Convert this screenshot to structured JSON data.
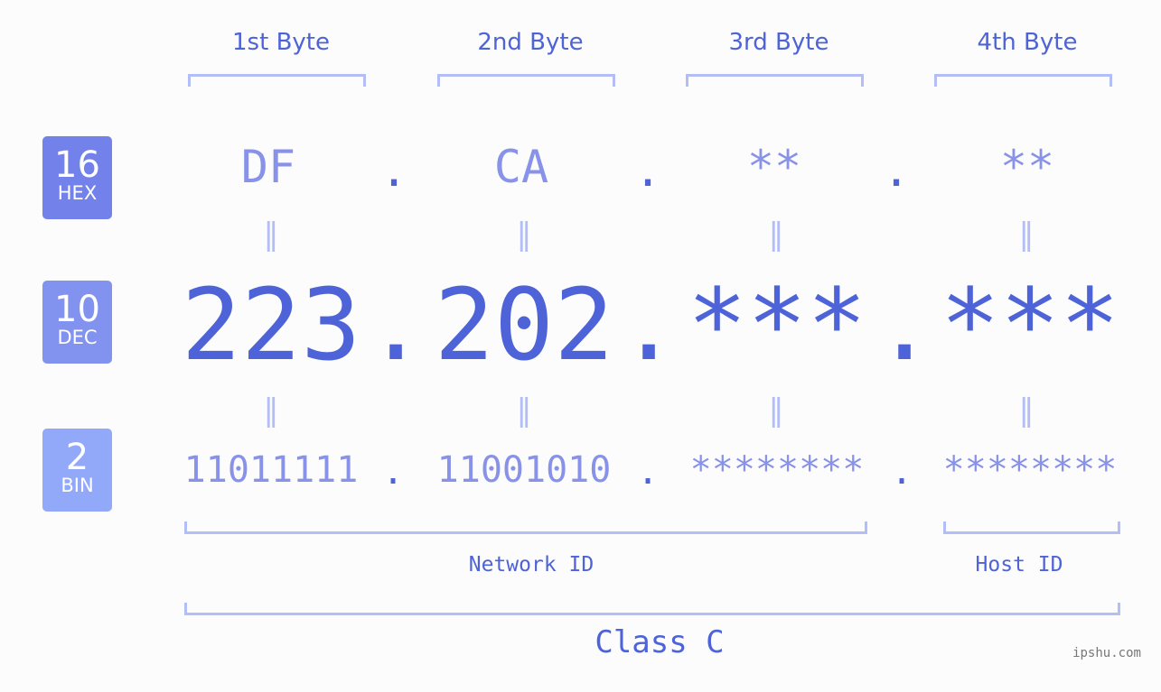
{
  "bytes": {
    "headers": [
      "1st Byte",
      "2nd Byte",
      "3rd Byte",
      "4th Byte"
    ],
    "hex": [
      "DF",
      "CA",
      "**",
      "**"
    ],
    "dec": [
      "223",
      "202",
      "***",
      "***"
    ],
    "bin": [
      "11011111",
      "11001010",
      "********",
      "********"
    ],
    "separator": ".",
    "equals": "="
  },
  "badges": {
    "hex": {
      "number": "16",
      "label": "HEX",
      "color": "#7282ea"
    },
    "dec": {
      "number": "10",
      "label": "DEC",
      "color": "#8292ef"
    },
    "bin": {
      "number": "2",
      "label": "BIN",
      "color": "#92a8f8"
    }
  },
  "labels": {
    "network_id": "Network ID",
    "host_id": "Host ID",
    "class": "Class C"
  },
  "watermark": "ipshu.com",
  "colors": {
    "primary": "#4e63d8",
    "light": "#8792e8",
    "bracket": "#b3bdf6"
  }
}
